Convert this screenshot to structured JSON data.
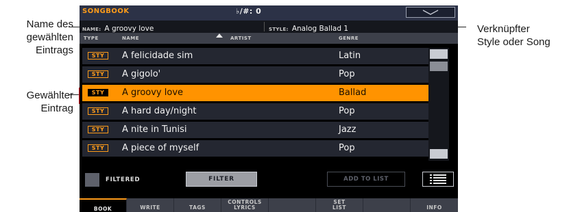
{
  "callouts": {
    "name_label": [
      "Name des",
      "gewählten",
      "Eintrags"
    ],
    "selected_label": [
      "Gewählter",
      "Eintrag"
    ],
    "linked_label": [
      "Verknüpfter",
      "Style oder Song"
    ]
  },
  "topbar": {
    "title": "SONGBOOK",
    "transpose": "♭/#: 0"
  },
  "current": {
    "name_label": "NAME:",
    "name_value": "A groovy love",
    "style_label": "STYLE:",
    "style_value": "Analog Ballad 1"
  },
  "columns": {
    "type": "TYPE",
    "name": "NAME",
    "artist": "ARTIST",
    "genre": "GENRE"
  },
  "rows": [
    {
      "type": "STY",
      "name": "A felicidade sim",
      "genre": "Latin",
      "selected": false
    },
    {
      "type": "STY",
      "name": "A gigolo'",
      "genre": "Pop",
      "selected": false
    },
    {
      "type": "STY",
      "name": "A groovy love",
      "genre": "Ballad",
      "selected": true
    },
    {
      "type": "STY",
      "name": "A hard day/night",
      "genre": "Pop",
      "selected": false
    },
    {
      "type": "STY",
      "name": "A nite in Tunisi",
      "genre": "Jazz",
      "selected": false
    },
    {
      "type": "STY",
      "name": "A piece of myself",
      "genre": "Pop",
      "selected": false
    }
  ],
  "controls": {
    "filtered_label": "FILTERED",
    "filter_button": "FILTER",
    "add_to_list_button": "ADD TO LIST",
    "list_icon": "list-view-icon"
  },
  "tabs": [
    {
      "label": "BOOK",
      "active": true
    },
    {
      "label": "WRITE",
      "active": false
    },
    {
      "label": "TAGS",
      "active": false
    },
    {
      "label": "CONTROLS LYRICS",
      "line1": "CONTROLS",
      "line2": "LYRICS",
      "active": false
    },
    {
      "label": "",
      "active": false
    },
    {
      "label": "SET LIST",
      "line1": "SET",
      "line2": "LIST",
      "active": false
    },
    {
      "label": "",
      "active": false
    },
    {
      "label": "INFO",
      "active": false
    }
  ],
  "colors": {
    "accent": "#ff9c1a",
    "selected_row": "#ff9300",
    "selection_marker": "#e8101c",
    "background": "#000000"
  }
}
